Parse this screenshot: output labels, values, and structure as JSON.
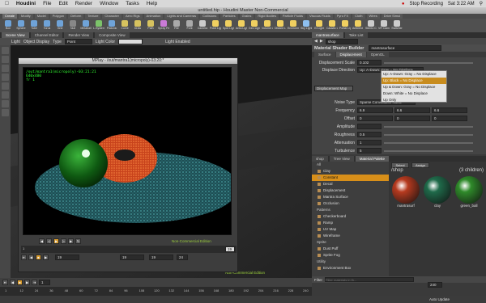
{
  "menubar": {
    "apple": "",
    "app": "Houdini",
    "items": [
      "File",
      "Edit",
      "Render",
      "Window",
      "Tasks",
      "Help"
    ],
    "right": {
      "stop": "Stop Recording",
      "time": "Sat 3:22 AM"
    }
  },
  "window_title": "untitled.hip - Houdini Master Non-Commercial",
  "shelf_tabs": [
    "Create",
    "Modify",
    "Model",
    "Polygon",
    "Deform",
    "Texture",
    "Character",
    "Aero Rigs",
    "Animation",
    "Lights and Cameras",
    "Collisions",
    "Particles",
    "Grains",
    "Rigid Bodies",
    "Particle Fluids",
    "Viscous Fluids",
    "Pyro FX",
    "Cloth",
    "Wires",
    "Drive Simul"
  ],
  "shelf_tools": [
    {
      "label": "Box",
      "c": "#6fa3d8"
    },
    {
      "label": "Sphere",
      "c": "#6fa3d8"
    },
    {
      "label": "Tube",
      "c": "#6fa3d8"
    },
    {
      "label": "Torus",
      "c": "#6fa3d8"
    },
    {
      "label": "Grid",
      "c": "#6fa3d8"
    },
    {
      "label": "Null",
      "c": "#888"
    },
    {
      "label": "Metaball",
      "c": "#6fa3d8"
    },
    {
      "label": "L-System",
      "c": "#7cc36a"
    },
    {
      "label": "Platonic",
      "c": "#6fa3d8"
    },
    {
      "label": "Curve",
      "c": "#d7c35f"
    },
    {
      "label": "Draw",
      "c": "#d7c35f"
    },
    {
      "label": "Path",
      "c": "#d7c35f"
    },
    {
      "label": "Spray Paint",
      "c": "#c97ad6"
    },
    {
      "label": "File",
      "c": "#aaa"
    },
    {
      "label": "Font",
      "c": "#aaa"
    },
    {
      "label": "Camera",
      "c": "#ccc"
    },
    {
      "label": "Point Light",
      "c": "#f0d060"
    },
    {
      "label": "Spot Light",
      "c": "#f0d060"
    },
    {
      "label": "Area Light",
      "c": "#f0d060"
    },
    {
      "label": "Geo Light",
      "c": "#f0d060"
    },
    {
      "label": "Volume Light",
      "c": "#f0d060"
    },
    {
      "label": "Distant Light",
      "c": "#f0d060"
    },
    {
      "label": "Environment",
      "c": "#f0d060"
    },
    {
      "label": "Sky Light",
      "c": "#8ec0f0"
    },
    {
      "label": "GI Light",
      "c": "#f0d060"
    },
    {
      "label": "Caustic Light",
      "c": "#f0d060"
    },
    {
      "label": "Portal Light",
      "c": "#f0d060"
    },
    {
      "label": "Ambient Light",
      "c": "#f0d060"
    },
    {
      "label": "Stereo Camera",
      "c": "#ccc"
    },
    {
      "label": "VR Camera",
      "c": "#ccc"
    },
    {
      "label": "Switcher",
      "c": "#ccc"
    }
  ],
  "left_pane_tabs": [
    "Scene View",
    "Channel Editor",
    "Render View",
    "Composite View"
  ],
  "viewport_toolbar": {
    "mode": "Light",
    "object_display": "Object Display",
    "type_label": "Type",
    "type_value": "Point",
    "light_color": "Light Color",
    "light_enabled": "Light Enabled"
  },
  "mplay": {
    "title": "MPlay - /out/mantra1(micropoly)-03:20:*",
    "info_lines": [
      "/out/mantra1(micropoly)-03:21:21",
      "640x480",
      "fr 1"
    ],
    "frame_a": "19",
    "frame_b": "19",
    "frame_c": "19",
    "frame_end": "19",
    "step": "24",
    "watermark": "Non-Commercial Edition"
  },
  "viewport_watermark": "Non-Commercial Edition",
  "right_top_tabs": [
    "mantrasurface",
    "Take List"
  ],
  "right_path": {
    "path": "shop"
  },
  "shader": {
    "kind": "Material Shader Builder",
    "name": "mantrasurface"
  },
  "parm_tabs": [
    "Surface",
    "Displacement",
    "OpenGL"
  ],
  "parms": {
    "disp_scale_label": "Displacement Scale",
    "disp_scale": "0.102",
    "disp_dir_label": "Displace Direction",
    "disp_dir": "Up: A-Down: Gray = No Displace",
    "disp_map_label": "Displacement Map",
    "disp_map_btn": "Displacement Map",
    "noise_type_label": "Noise Type",
    "noise_type": "Sparse Convolution Noise",
    "freq_label": "Frequency",
    "freq": [
      "6.9",
      "6.6",
      "6.6"
    ],
    "offset_label": "Offset",
    "offset": [
      "0",
      "0",
      "0"
    ],
    "amp_label": "Amplitude",
    "amp": "",
    "rough_label": "Roughness",
    "rough": "0.5",
    "atten_label": "Attenuation",
    "atten": "1",
    "turb_label": "Turbulence",
    "turb": "5"
  },
  "dropdown": {
    "items": [
      "Up: A-Down: Gray = No Displace",
      "Up: Black = No Displace",
      "Up & Down: Gray = No Displace",
      "Down: White = No Displace",
      "Up Only"
    ],
    "selected": 1
  },
  "tree_tabs": [
    "shop",
    "Tree View",
    "Material Palette"
  ],
  "tree": {
    "header": "All",
    "items": [
      {
        "t": "Clay",
        "k": "item"
      },
      {
        "t": "Constant",
        "k": "sel"
      },
      {
        "t": "Decal",
        "k": "item"
      },
      {
        "t": "Displacement",
        "k": "item"
      },
      {
        "t": "Mantra Surface",
        "k": "item"
      },
      {
        "t": "Occlusion",
        "k": "item"
      },
      {
        "t": "Patterns",
        "k": "cat"
      },
      {
        "t": "Checkerboard",
        "k": "item"
      },
      {
        "t": "Ramp",
        "k": "item"
      },
      {
        "t": "UV Map",
        "k": "item"
      },
      {
        "t": "Wireframe",
        "k": "item"
      },
      {
        "t": "Sprite",
        "k": "cat"
      },
      {
        "t": "Dust Puff",
        "k": "item"
      },
      {
        "t": "Sprite Fog",
        "k": "item"
      },
      {
        "t": "Utility",
        "k": "cat"
      },
      {
        "t": "Environment Box",
        "k": "item"
      }
    ]
  },
  "gallery": {
    "select": "Select",
    "assign": "Assign",
    "path": "/shop",
    "count": "(3 children)",
    "items": [
      {
        "label": "mantrasurf",
        "c": "#b63a1f"
      },
      {
        "label": "clay",
        "c": "#1f6a4a"
      },
      {
        "label": "green_ball",
        "c": "#2f8a2a"
      }
    ]
  },
  "filter": {
    "label": "Filter",
    "placeholder": "Filter materials in th..."
  },
  "playbar": {
    "frame": "1",
    "start": "1",
    "end": "240",
    "ticks": [
      "1",
      "12",
      "24",
      "36",
      "48",
      "60",
      "72",
      "84",
      "96",
      "108",
      "120",
      "132",
      "144",
      "156",
      "168",
      "180",
      "192",
      "204",
      "216",
      "228",
      "240"
    ]
  },
  "status": {
    "auto_update": "Auto Update"
  }
}
